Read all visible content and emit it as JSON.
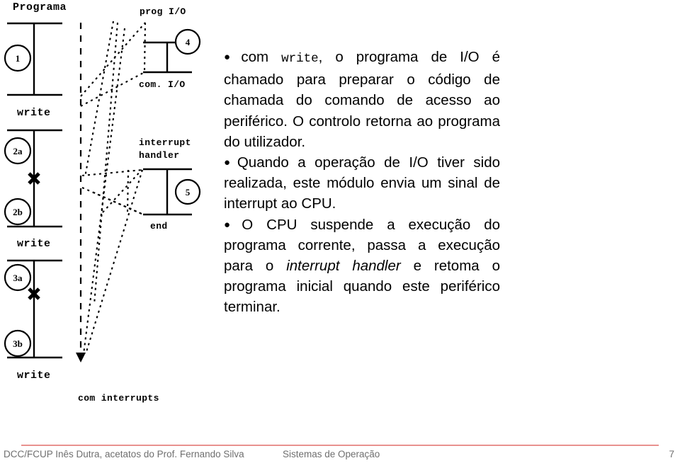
{
  "slide": {
    "title_left": "Programa",
    "diagram": {
      "left_column": {
        "header": "Programa",
        "segments": [
          {
            "id": "1",
            "label": "1"
          },
          {
            "id": "2a",
            "label": "2a"
          },
          {
            "id": "2b",
            "label": "2b"
          },
          {
            "id": "3a",
            "label": "3a"
          },
          {
            "id": "3b",
            "label": "3b"
          }
        ],
        "separators": [
          "write",
          "write",
          "write"
        ]
      },
      "right_column": {
        "blocks": [
          {
            "header": "prog I/O",
            "circle": "4",
            "footer": "com. I/O"
          },
          {
            "header_line1": "interrupt",
            "header_line2": "handler",
            "circle": "5",
            "footer": "end"
          }
        ]
      },
      "timeline_label": "com interrupts"
    }
  },
  "text": {
    "b1_bullet": "●",
    "b1_part1": "com ",
    "b1_code": "write",
    "b1_part2": ", o programa de I/O é chamado para preparar o código de chamada do comando de acesso ao periférico. O controlo retorna ao programa do utilizador.",
    "b2_bullet": "●",
    "b2_text": "Quando a operação de I/O tiver sido realizada, este módulo envia um sinal de interrupt ao CPU.",
    "b3_bullet": "●",
    "b3_part1": "O CPU suspende a execução do programa corrente, passa a execução para o ",
    "b3_italic": "interrupt handler",
    "b3_part2": " e retoma o programa inicial quando este periférico terminar."
  },
  "footer": {
    "left": "DCC/FCUP Inês Dutra, acetatos do Prof. Fernando Silva",
    "center": "Sistemas de Operação",
    "page": "7",
    "rule_color": "#e8928f"
  }
}
